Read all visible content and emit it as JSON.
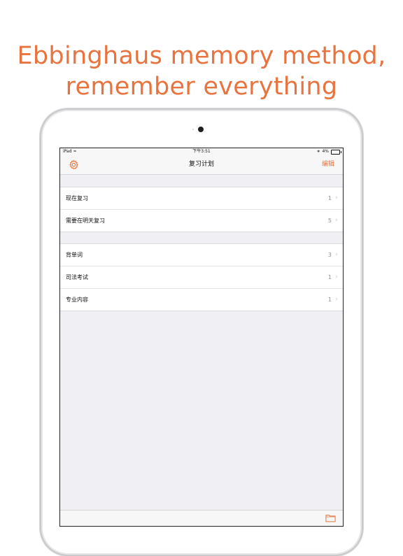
{
  "headline": {
    "line1": "Ebbinghaus memory method,",
    "line2": "remember everything"
  },
  "status_bar": {
    "device": "iPad",
    "time": "下午3:51",
    "battery": "4%"
  },
  "nav": {
    "title": "复习计划",
    "edit_label": "编辑",
    "settings_icon": "gear-icon"
  },
  "review_section": [
    {
      "label": "现在复习",
      "count": "1"
    },
    {
      "label": "需要在明天复习",
      "count": "5"
    }
  ],
  "plans_section": [
    {
      "label": "背单词",
      "count": "3"
    },
    {
      "label": "司法考试",
      "count": "1"
    },
    {
      "label": "专业内容",
      "count": "1"
    }
  ],
  "toolbar": {
    "folder_icon": "folder-icon"
  },
  "colors": {
    "accent": "#e8733f",
    "background": "#efeff4"
  }
}
